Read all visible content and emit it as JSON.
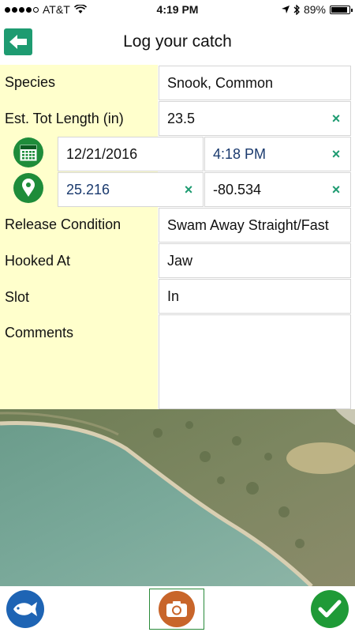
{
  "status": {
    "carrier": "AT&T",
    "time": "4:19 PM",
    "battery": "89%",
    "battery_level": 0.89
  },
  "header": {
    "title": "Log your catch"
  },
  "form": {
    "species": {
      "label": "Species",
      "value": "Snook, Common"
    },
    "length": {
      "label": "Est. Tot Length (in)",
      "value": "23.5"
    },
    "date": {
      "value": "12/21/2016"
    },
    "time": {
      "value": "4:18 PM"
    },
    "latitude": {
      "value": "25.216"
    },
    "longitude": {
      "value": "-80.534"
    },
    "release": {
      "label": "Release Condition",
      "value": "Swam Away Straight/Fast"
    },
    "hooked": {
      "label": "Hooked At",
      "value": "Jaw"
    },
    "slot": {
      "label": "Slot",
      "value": "In"
    },
    "comments": {
      "label": "Comments",
      "value": ""
    }
  },
  "clear_symbol": "×",
  "colors": {
    "accent": "#1e9b71",
    "label_bg": "#ffffcc",
    "icon_green": "#1e8c3a",
    "fish_blue": "#1e64b4",
    "camera_orange": "#c8652a"
  },
  "icons": [
    "back-arrow-icon",
    "calendar-icon",
    "location-pin-icon",
    "fish-icon",
    "camera-icon",
    "checkmark-icon"
  ]
}
